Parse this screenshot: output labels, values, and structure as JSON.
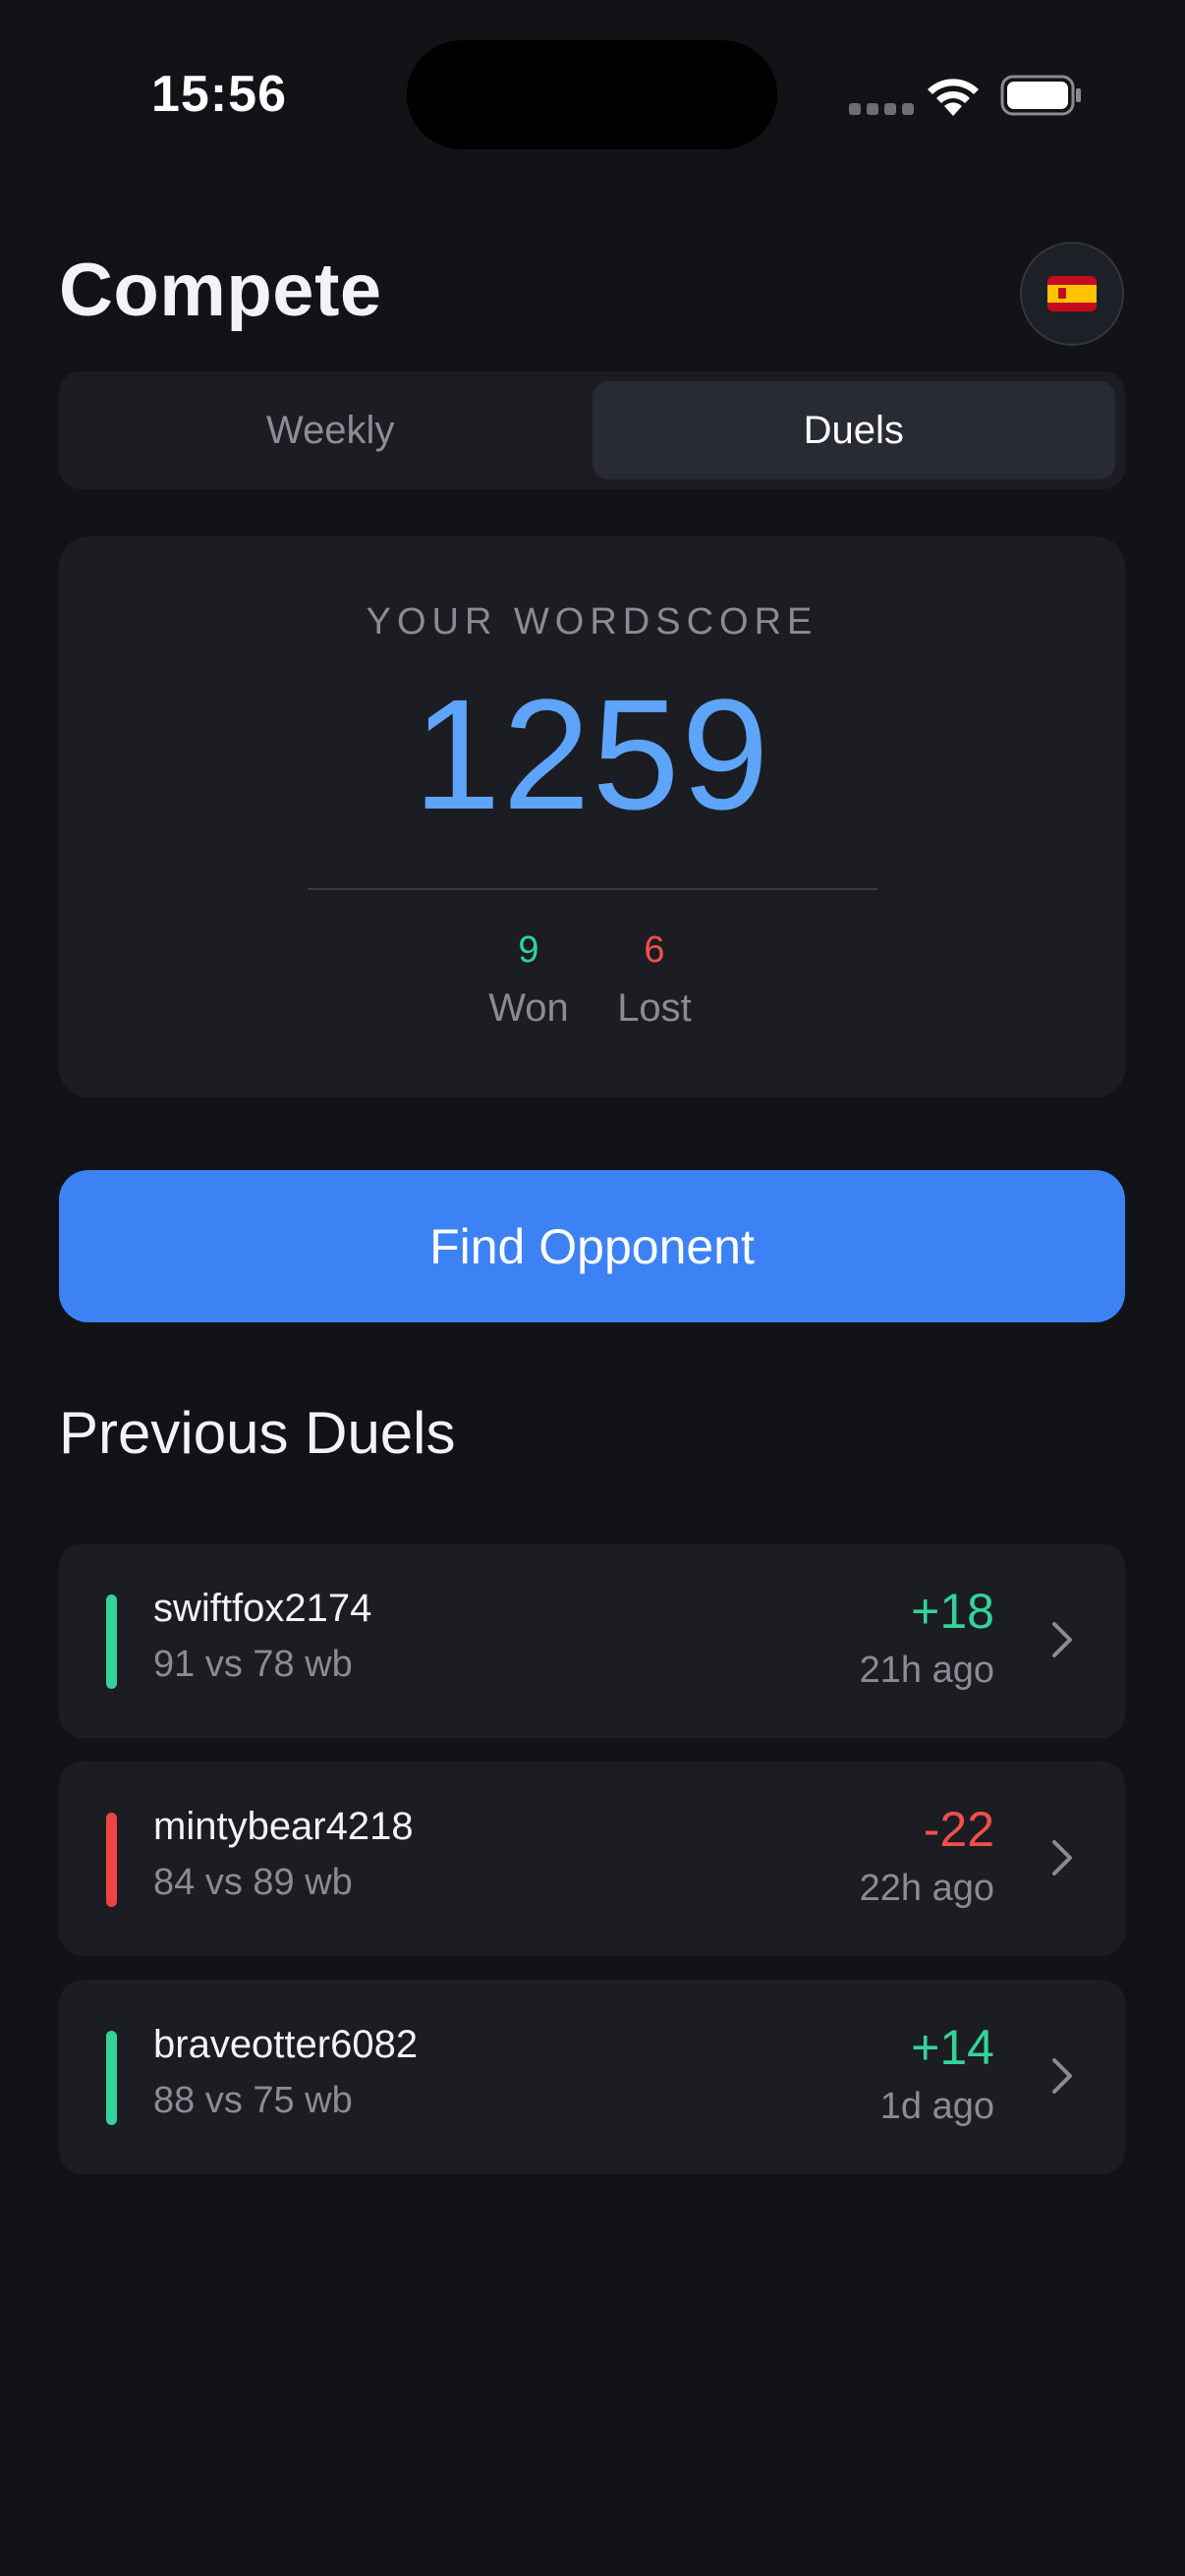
{
  "status_bar": {
    "time": "15:56",
    "icons": [
      "signal-icon",
      "wifi-icon",
      "battery-icon"
    ]
  },
  "header": {
    "title": "Compete",
    "language_flag": "spain-flag-icon"
  },
  "tabs": [
    {
      "label": "Weekly",
      "active": false
    },
    {
      "label": "Duels",
      "active": true
    }
  ],
  "score_card": {
    "label": "YOUR WORDSCORE",
    "score": "1259",
    "won_count": "9",
    "won_label": "Won",
    "lost_count": "6",
    "lost_label": "Lost"
  },
  "find_opponent_label": "Find Opponent",
  "previous_duels": {
    "title": "Previous Duels",
    "items": [
      {
        "opponent": "swiftfox2174",
        "score": "91 vs 78 wb",
        "change": "+18",
        "time": "21h ago",
        "result": "win"
      },
      {
        "opponent": "mintybear4218",
        "score": "84 vs 89 wb",
        "change": "-22",
        "time": "22h ago",
        "result": "loss"
      },
      {
        "opponent": "braveotter6082",
        "score": "88 vs 75 wb",
        "change": "+14",
        "time": "1d ago",
        "result": "win"
      }
    ]
  },
  "colors": {
    "background": "#121316",
    "card": "#1b1d22",
    "accent": "#3d82f4",
    "score": "#5ea4f8",
    "win": "#34d399",
    "loss": "#ef4444",
    "muted_text": "#8a8c93"
  }
}
